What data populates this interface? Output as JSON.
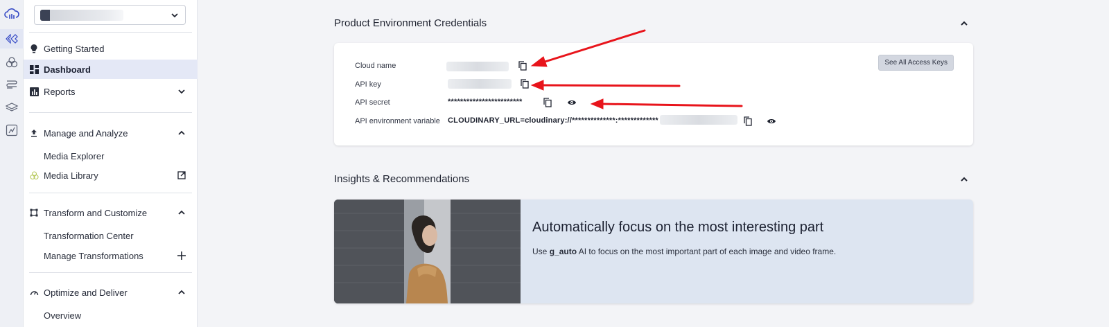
{
  "sidebar": {
    "items": [
      {
        "label": "Getting Started"
      },
      {
        "label": "Dashboard"
      },
      {
        "label": "Reports"
      },
      {
        "label": "Manage and Analyze"
      },
      {
        "label": "Media Explorer"
      },
      {
        "label": "Media Library"
      },
      {
        "label": "Transform and Customize"
      },
      {
        "label": "Transformation Center"
      },
      {
        "label": "Manage Transformations"
      },
      {
        "label": "Optimize and Deliver"
      },
      {
        "label": "Overview"
      }
    ]
  },
  "credentials": {
    "title": "Product Environment Credentials",
    "see_all_label": "See All Access Keys",
    "cloud_name_label": "Cloud name",
    "api_key_label": "API key",
    "api_secret_label": "API secret",
    "api_secret_value": "************************",
    "api_env_label": "API environment variable",
    "api_env_value": "CLOUDINARY_URL=cloudinary://**************:*************"
  },
  "insights": {
    "title": "Insights & Recommendations",
    "card_title": "Automatically focus on the most interesting part",
    "desc_prefix": "Use ",
    "desc_bold": "g_auto",
    "desc_suffix": " AI to focus on the most important part of each image and video frame."
  },
  "colors": {
    "accent": "#3448c5",
    "arrow": "#e8141b",
    "active_bg": "#e4e8f6",
    "insight_bg": "#dde5f1"
  },
  "icons": [
    "cloudinary-logo-icon",
    "dashboard-rail-icon",
    "assets-rail-icon",
    "transform-rail-icon",
    "layers-rail-icon",
    "optimize-rail-icon",
    "lightbulb-icon",
    "grid-icon",
    "bar-chart-icon",
    "upload-icon",
    "flower-icon",
    "external-link-icon",
    "crop-icon",
    "plus-icon",
    "gauge-icon",
    "copy-icon",
    "eye-icon",
    "chevron-up-icon",
    "chevron-down-icon"
  ]
}
